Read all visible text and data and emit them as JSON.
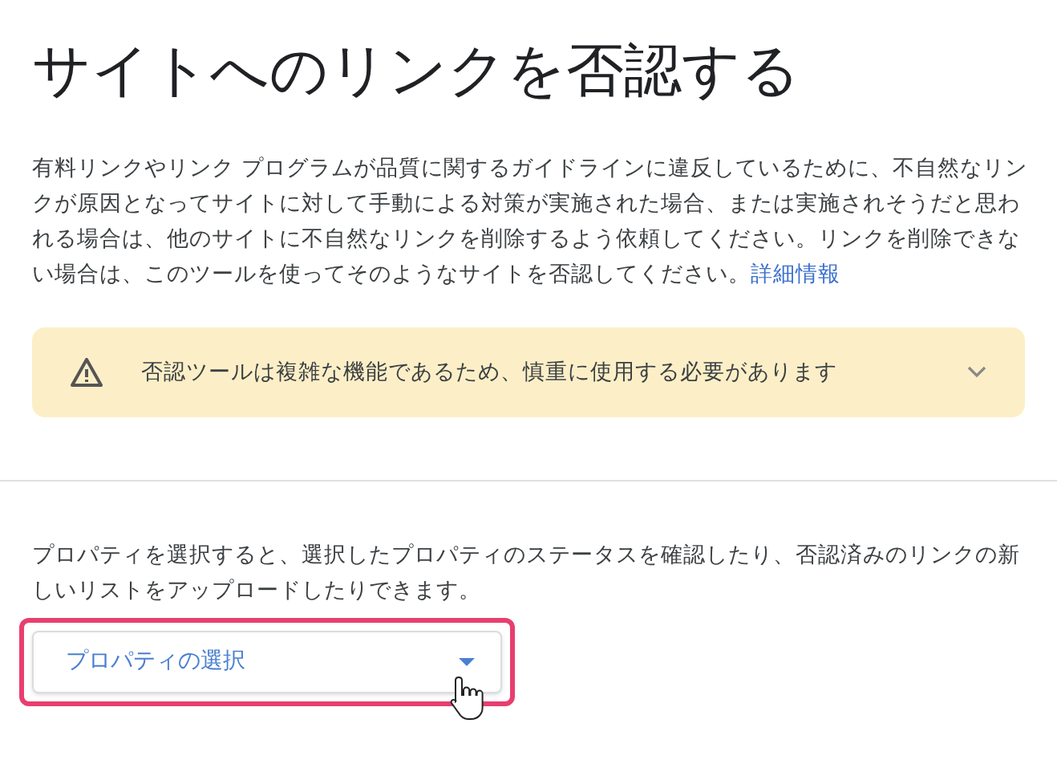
{
  "title": "サイトへのリンクを否認する",
  "description": {
    "text": "有料リンクやリンク プログラムが品質に関するガイドラインに違反しているために、不自然なリンクが原因となってサイトに対して手動による対策が実施された場合、または実施されそうだと思われる場合は、他のサイトに不自然なリンクを削除するよう依頼してください。リンクを削除できない場合は、このツールを使ってそのようなサイトを否認してください。",
    "link": "詳細情報"
  },
  "warning": {
    "text": "否認ツールは複雑な機能であるため、慎重に使用する必要があります",
    "expanded": false
  },
  "property_text": "プロパティを選択すると、選択したプロパティのステータスを確認したり、否認済みのリンクの新しいリストをアップロードしたりできます。",
  "property_select": {
    "placeholder": "プロパティの選択",
    "highlighted": true
  }
}
